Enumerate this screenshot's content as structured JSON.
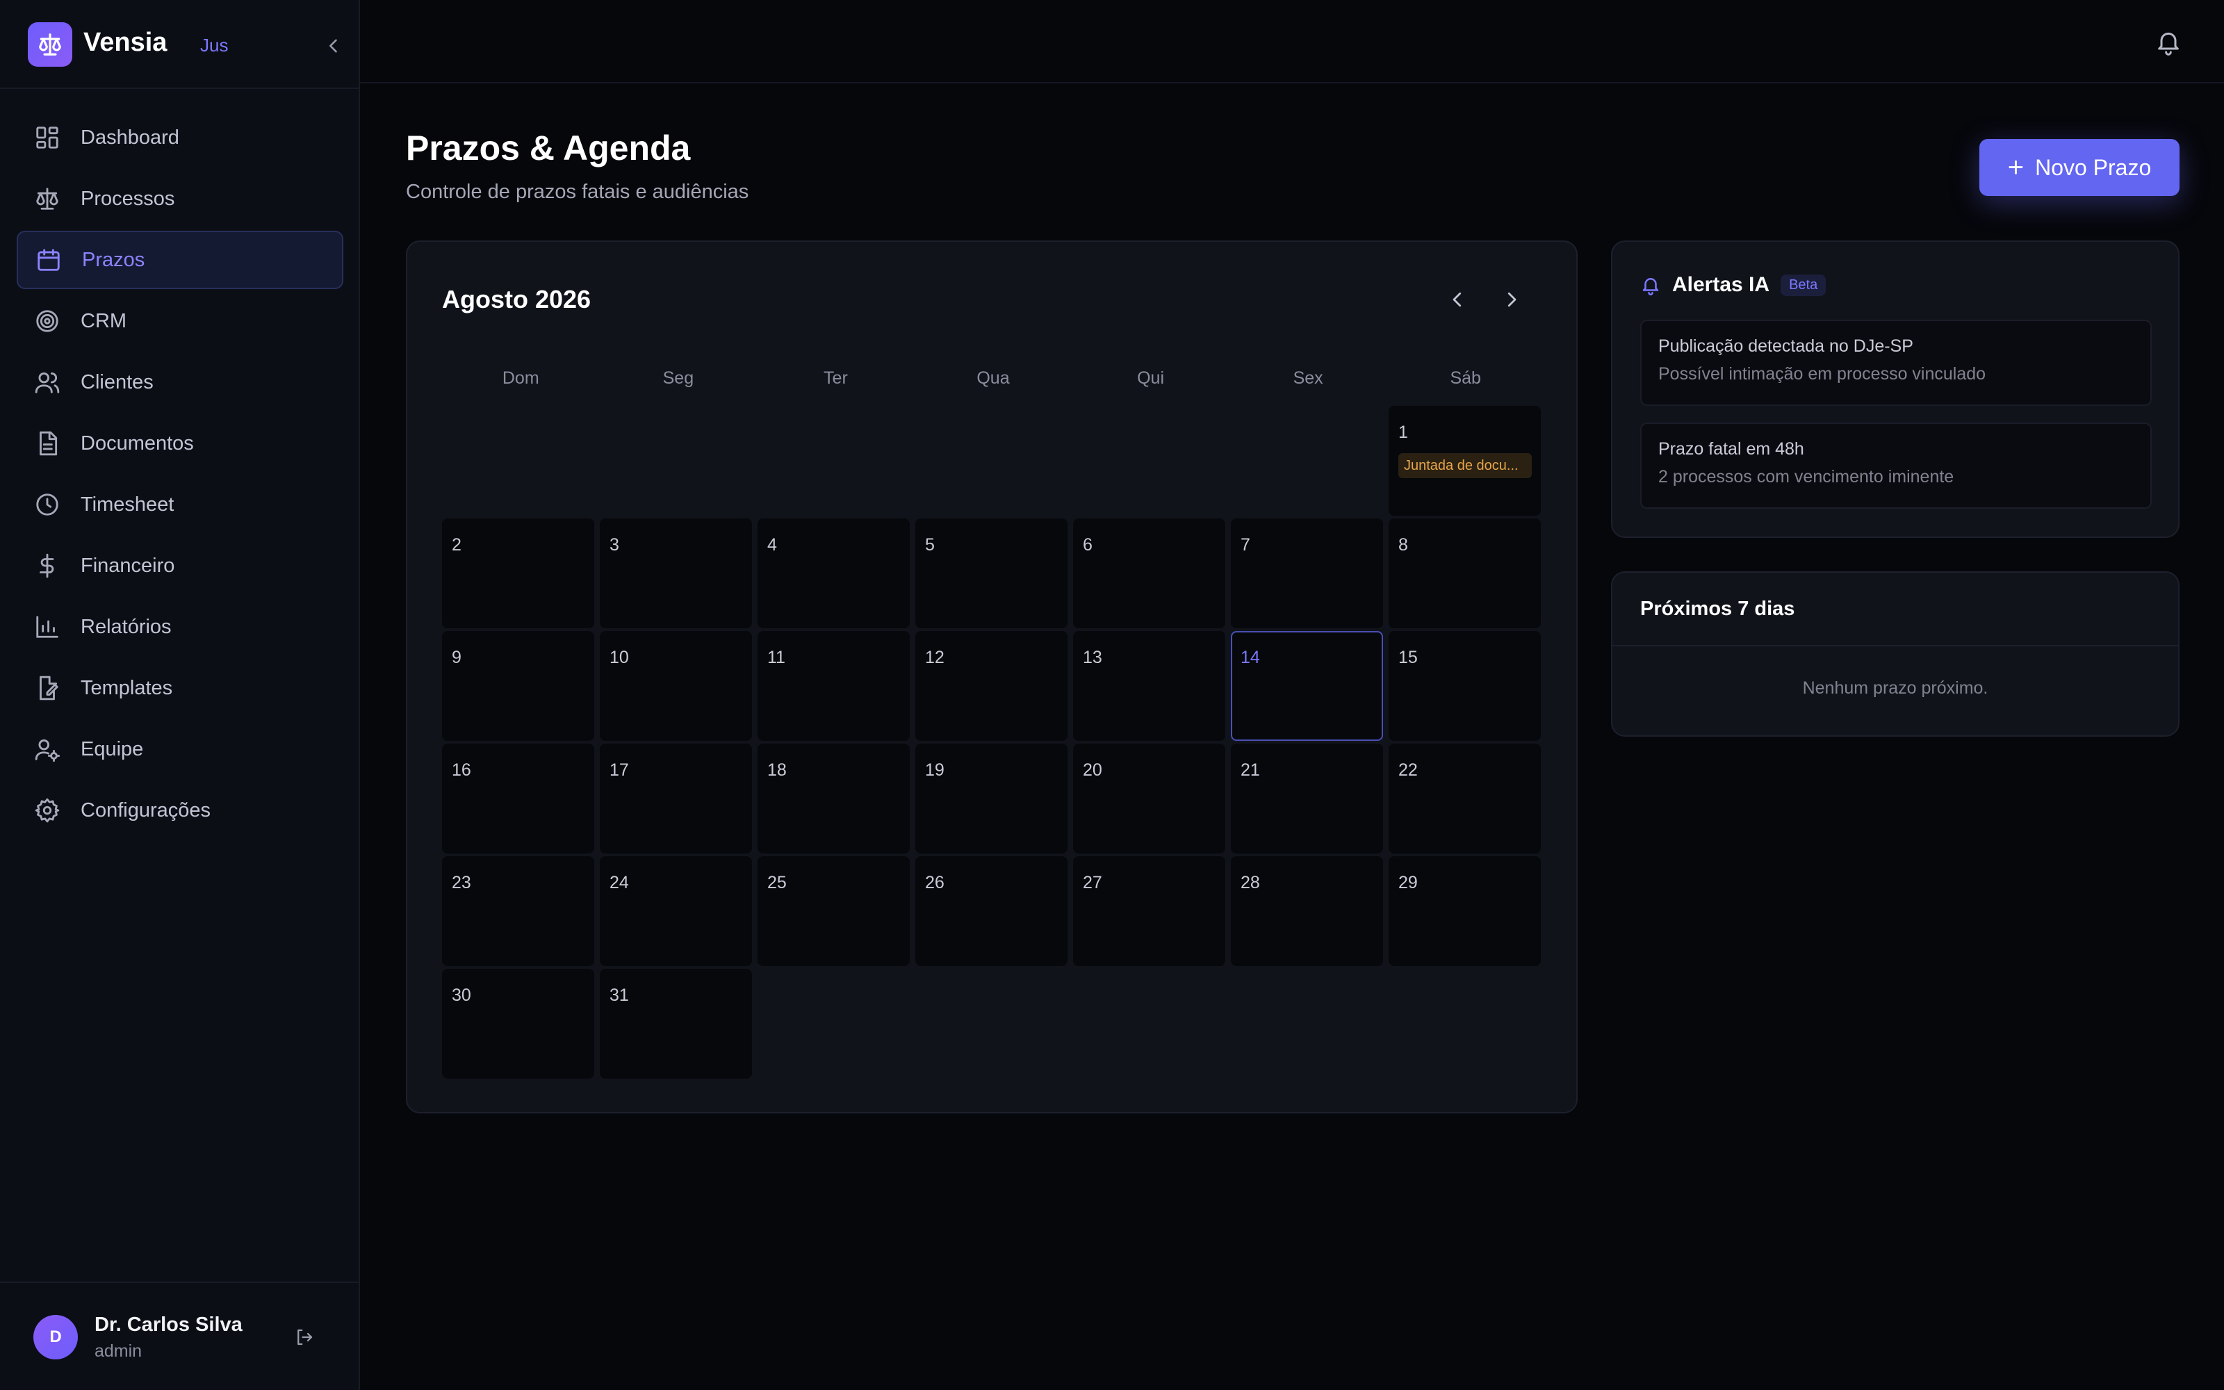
{
  "brand": {
    "name": "Vensia",
    "tag": "Jus"
  },
  "sidebar": {
    "items": [
      {
        "label": "Dashboard",
        "icon": "dashboard-icon"
      },
      {
        "label": "Processos",
        "icon": "scale-icon"
      },
      {
        "label": "Prazos",
        "icon": "calendar-icon",
        "active": true
      },
      {
        "label": "CRM",
        "icon": "target-icon"
      },
      {
        "label": "Clientes",
        "icon": "users-icon"
      },
      {
        "label": "Documentos",
        "icon": "document-icon"
      },
      {
        "label": "Timesheet",
        "icon": "clock-icon"
      },
      {
        "label": "Financeiro",
        "icon": "dollar-icon"
      },
      {
        "label": "Relatórios",
        "icon": "bar-chart-icon"
      },
      {
        "label": "Templates",
        "icon": "edit-document-icon"
      },
      {
        "label": "Equipe",
        "icon": "user-gear-icon"
      },
      {
        "label": "Configurações",
        "icon": "gear-icon"
      }
    ]
  },
  "user": {
    "initial": "D",
    "name": "Dr. Carlos Silva",
    "role": "admin"
  },
  "page": {
    "title": "Prazos & Agenda",
    "subtitle": "Controle de prazos fatais e audiências",
    "new_button": "Novo Prazo"
  },
  "calendar": {
    "month_label": "Agosto 2026",
    "weekdays": [
      "Dom",
      "Seg",
      "Ter",
      "Qua",
      "Qui",
      "Sex",
      "Sáb"
    ],
    "first_weekday_index": 6,
    "days_in_month": 31,
    "today": 14,
    "events": [
      {
        "day": 1,
        "label": "Juntada de docu..."
      }
    ]
  },
  "alerts": {
    "title": "Alertas IA",
    "badge": "Beta",
    "items": [
      {
        "title": "Publicação detectada no DJe-SP",
        "description": "Possível intimação em processo vinculado"
      },
      {
        "title": "Prazo fatal em 48h",
        "description": "2 processos com vencimento iminente"
      }
    ]
  },
  "upcoming": {
    "title": "Próximos 7 dias",
    "empty_message": "Nenhum prazo próximo."
  },
  "colors": {
    "accent": "#6366f1",
    "event": "#e8a54a",
    "background": "#06070b"
  }
}
